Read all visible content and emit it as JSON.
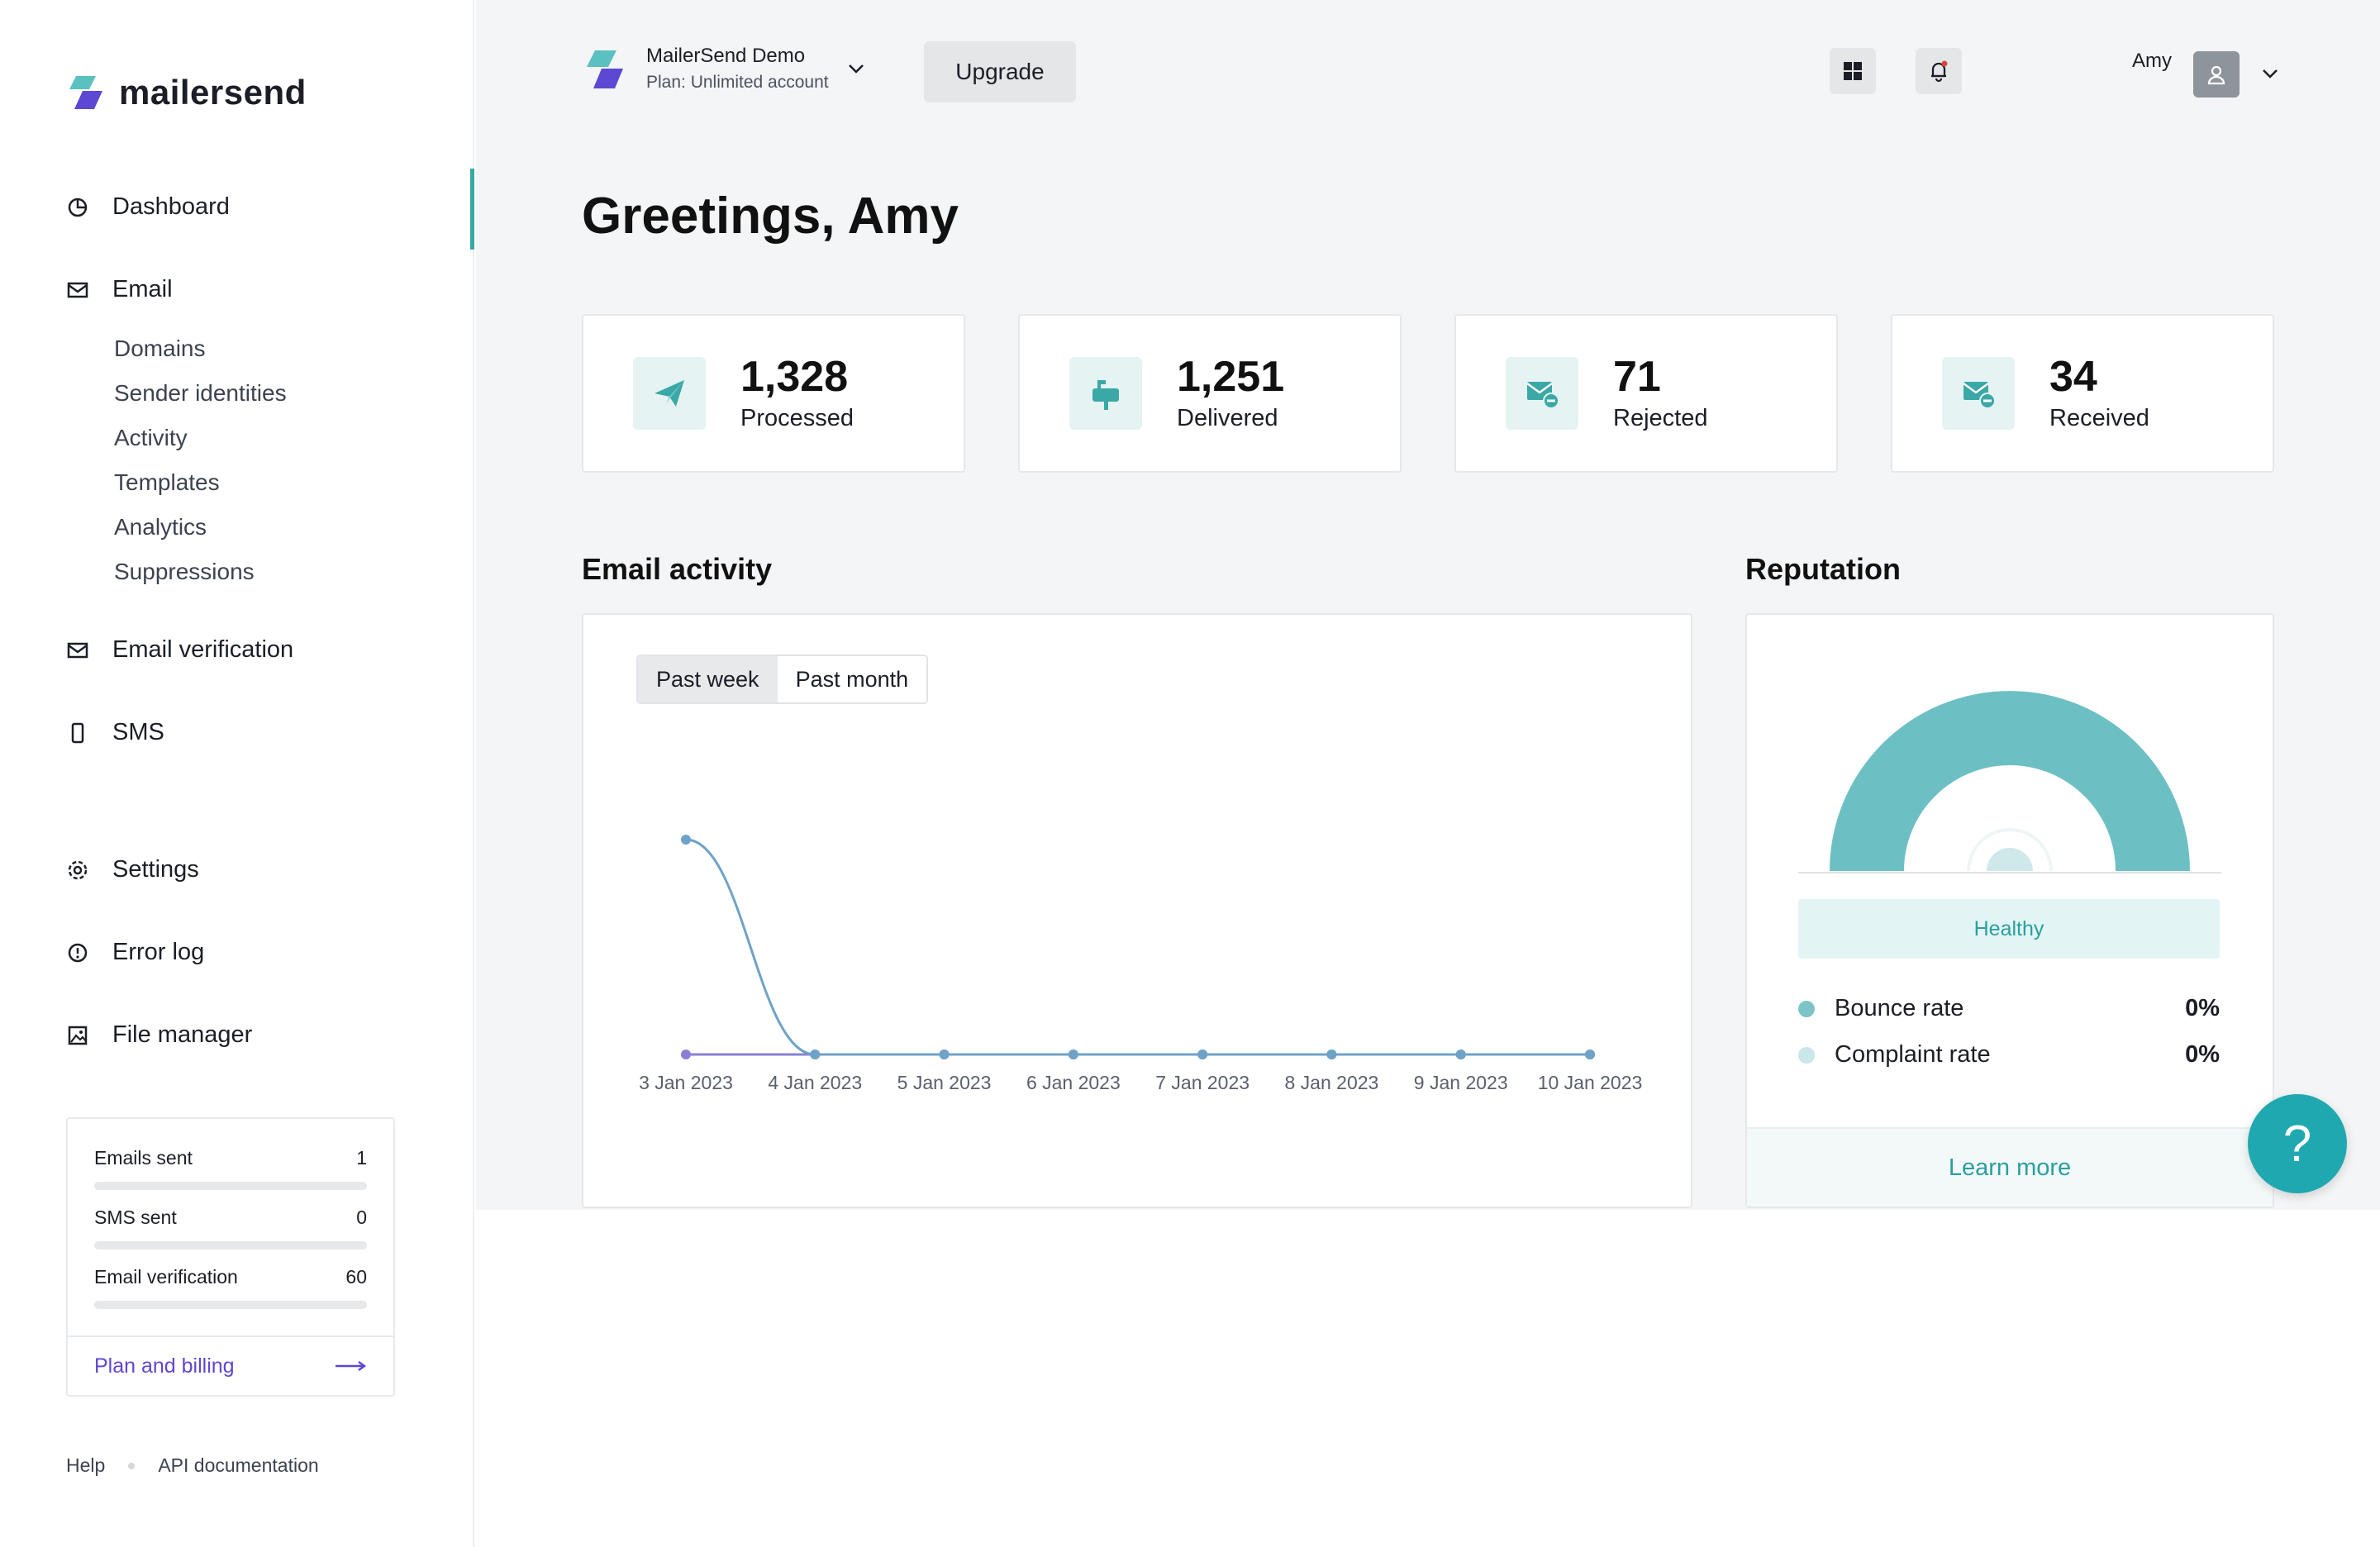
{
  "brand": {
    "name": "mailersend",
    "accent": "#3aa8a6",
    "purple": "#5c48d3"
  },
  "sidebar": {
    "items": [
      {
        "label": "Dashboard",
        "icon": "pie-chart-icon"
      },
      {
        "label": "Email",
        "icon": "inbox-icon"
      },
      {
        "label": "Email verification",
        "icon": "mail-check-icon"
      },
      {
        "label": "SMS",
        "icon": "phone-icon"
      },
      {
        "label": "Settings",
        "icon": "gear-icon"
      },
      {
        "label": "Error log",
        "icon": "alert-circle-icon"
      },
      {
        "label": "File manager",
        "icon": "image-icon"
      }
    ],
    "email_subitems": [
      "Domains",
      "Sender identities",
      "Activity",
      "Templates",
      "Analytics",
      "Suppressions"
    ],
    "usage": [
      {
        "label": "Emails sent",
        "value": "1",
        "fill": 0.0
      },
      {
        "label": "SMS sent",
        "value": "0",
        "fill": 0.0
      },
      {
        "label": "Email verification",
        "value": "60",
        "fill": 0.0
      }
    ],
    "plan_billing": "Plan and billing",
    "footer_links": [
      "Help",
      "API documentation"
    ]
  },
  "header": {
    "workspace_name": "MailerSend Demo",
    "workspace_plan": "Plan: Unlimited account",
    "upgrade_label": "Upgrade",
    "user_name": "Amy"
  },
  "greeting": {
    "bold": "Greetings,",
    "name": "Amy"
  },
  "stats": [
    {
      "value": "1,328",
      "label": "Processed",
      "icon": "paper-plane-icon"
    },
    {
      "value": "1,251",
      "label": "Delivered",
      "icon": "mailbox-icon"
    },
    {
      "value": "71",
      "label": "Rejected",
      "icon": "mail-minus-icon"
    },
    {
      "value": "34",
      "label": "Received",
      "icon": "mail-minus-icon"
    }
  ],
  "activity": {
    "title": "Email activity",
    "tabs": [
      "Past week",
      "Past month"
    ],
    "active_tab": "Past week"
  },
  "chart_data": {
    "type": "line",
    "categories": [
      "3 Jan 2023",
      "4 Jan 2023",
      "5 Jan 2023",
      "6 Jan 2023",
      "7 Jan 2023",
      "8 Jan 2023",
      "9 Jan 2023",
      "10 Jan 2023"
    ],
    "series": [
      {
        "values": [
          1,
          0,
          0,
          0,
          0,
          0,
          0,
          0
        ],
        "color": "#6fa2c7"
      },
      {
        "values": [
          0,
          0,
          0,
          0,
          0,
          0,
          0,
          0
        ],
        "color": "#8a7fd6"
      }
    ],
    "ylim": [
      0,
      1
    ],
    "grid": false
  },
  "reputation": {
    "title": "Reputation",
    "status": "Healthy",
    "gauge_level": 1.0,
    "rates": [
      {
        "label": "Bounce rate",
        "value": "0%",
        "color": "#7cc4c8"
      },
      {
        "label": "Complaint rate",
        "value": "0%",
        "color": "#c9e6e8"
      }
    ],
    "learn_more": "Learn more"
  },
  "help_fab": "?"
}
